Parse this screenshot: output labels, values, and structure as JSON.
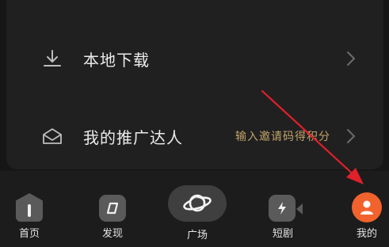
{
  "menu": {
    "local_download": {
      "label": "本地下载",
      "icon": "download-icon"
    },
    "promoter": {
      "label": "我的推广达人",
      "hint": "输入邀请码得积分",
      "icon": "envelope-icon"
    }
  },
  "tabs": [
    {
      "label": "首页",
      "icon": "home-icon"
    },
    {
      "label": "发现",
      "icon": "compass-icon"
    },
    {
      "label": "广场",
      "icon": "planet-icon"
    },
    {
      "label": "短剧",
      "icon": "short-drama-icon"
    },
    {
      "label": "我的",
      "icon": "user-icon"
    }
  ],
  "colors": {
    "accent": "#f2622c",
    "hint": "#c2a36a",
    "annotation_arrow": "#e0202a"
  }
}
